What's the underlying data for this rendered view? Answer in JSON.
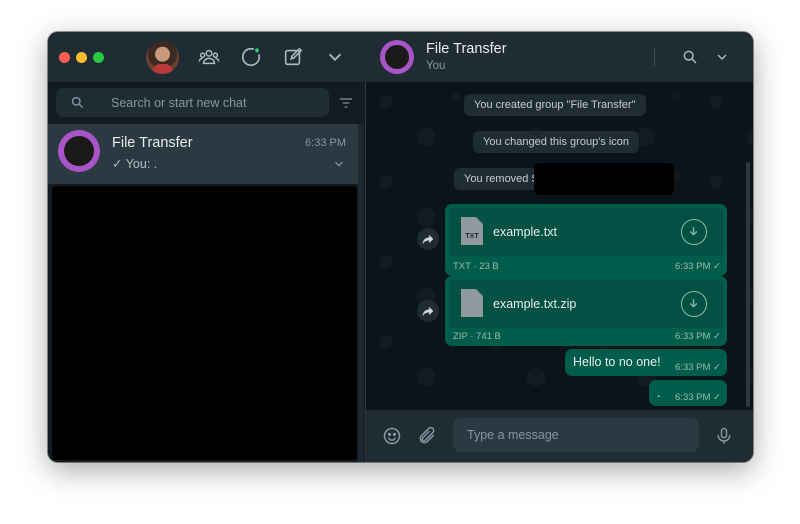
{
  "left_header": {
    "icons": [
      "community-icon",
      "status-icon",
      "new-chat-icon",
      "menu-chevron-icon"
    ]
  },
  "search": {
    "placeholder": "Search or start new chat"
  },
  "chats": [
    {
      "name": "File Transfer",
      "time": "6:33 PM",
      "preview": "✓ You: ."
    }
  ],
  "conversation": {
    "title": "File Transfer",
    "subtitle": "You",
    "system_messages": [
      "You created group \"File Transfer\"",
      "You changed this group's icon",
      "You removed S"
    ],
    "files": [
      {
        "type_label": "TXT",
        "name": "example.txt",
        "meta": "TXT · 23 B",
        "time": "6:33 PM ✓"
      },
      {
        "type_label": "",
        "name": "example.txt.zip",
        "meta": "ZIP · 741 B",
        "time": "6:33 PM ✓"
      }
    ],
    "texts": [
      {
        "text": "Hello to no one!",
        "time": "6:33 PM ✓"
      },
      {
        "text": ".",
        "time": "6:33 PM ✓"
      }
    ]
  },
  "composer": {
    "placeholder": "Type a message"
  },
  "colors": {
    "outgoing_bubble": "#005c4b",
    "header": "#202c33",
    "background": "#111b21",
    "group_avatar": "#a855c7"
  }
}
